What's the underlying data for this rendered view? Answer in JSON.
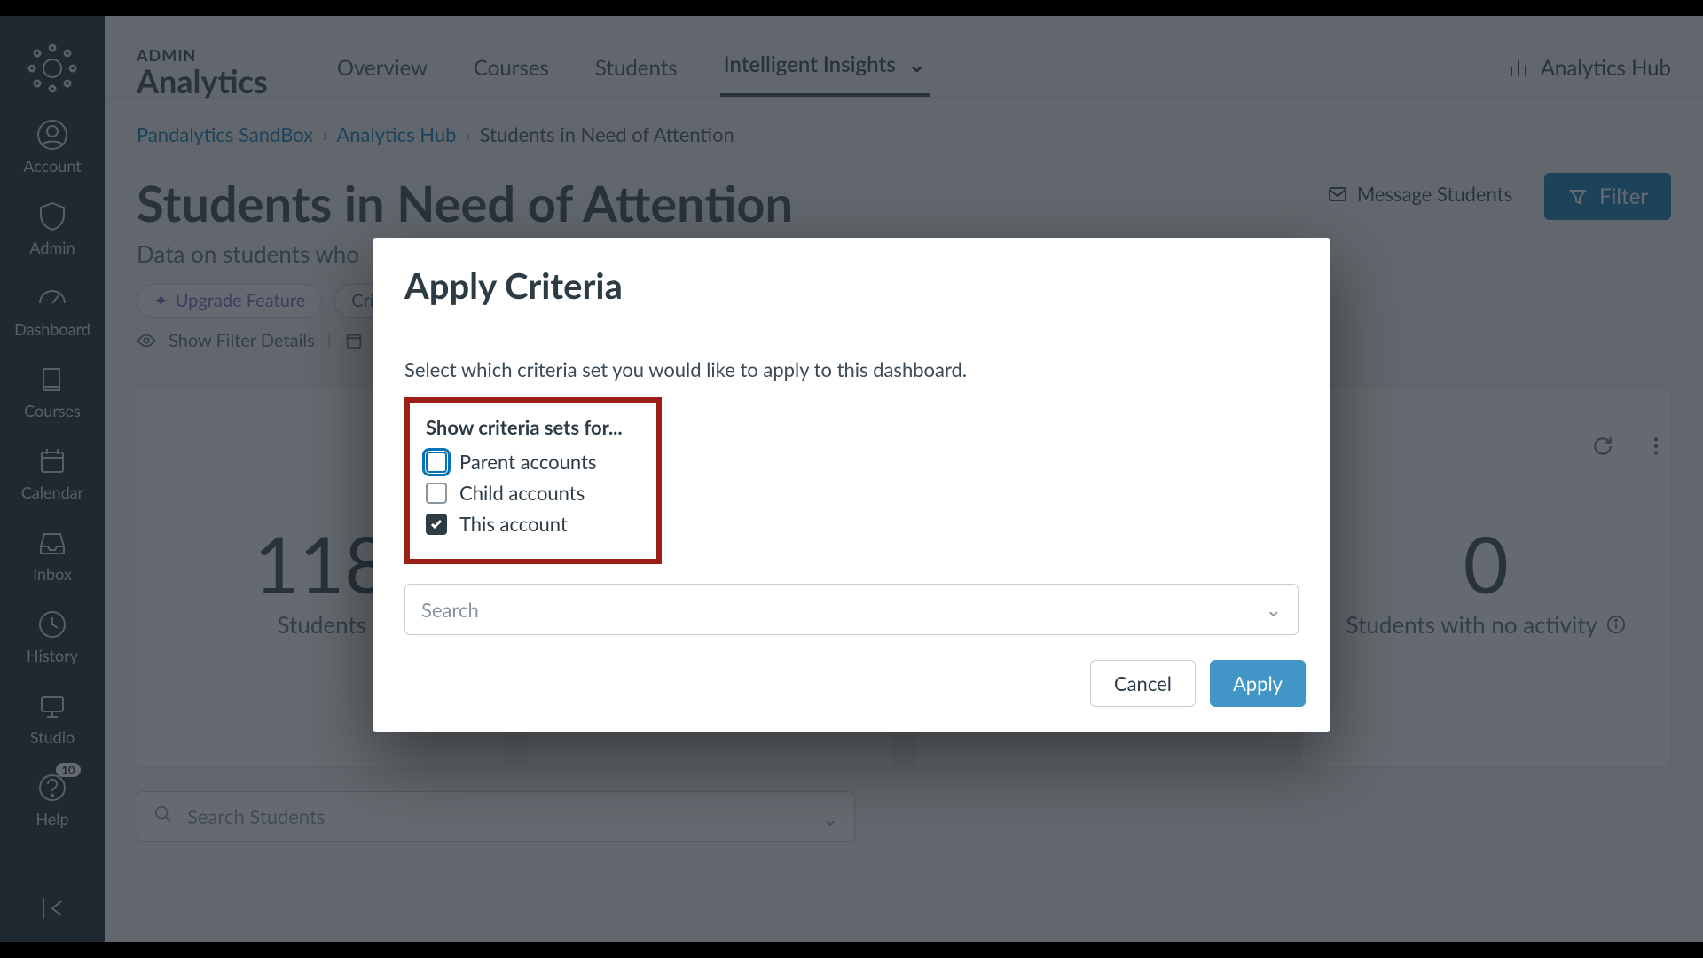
{
  "brand": {
    "sup": "ADMIN",
    "big": "Analytics"
  },
  "gnav": {
    "items": [
      {
        "key": "account",
        "label": "Account"
      },
      {
        "key": "admin",
        "label": "Admin"
      },
      {
        "key": "dashboard",
        "label": "Dashboard"
      },
      {
        "key": "courses",
        "label": "Courses"
      },
      {
        "key": "calendar",
        "label": "Calendar"
      },
      {
        "key": "inbox",
        "label": "Inbox"
      },
      {
        "key": "history",
        "label": "History"
      },
      {
        "key": "studio",
        "label": "Studio"
      },
      {
        "key": "help",
        "label": "Help",
        "badge": "10"
      }
    ]
  },
  "topnav": {
    "items": [
      {
        "label": "Overview"
      },
      {
        "label": "Courses"
      },
      {
        "label": "Students"
      },
      {
        "label": "Intelligent Insights",
        "active": true,
        "dropdown": true
      }
    ],
    "hub": "Analytics Hub"
  },
  "crumbs": [
    {
      "label": "Pandalytics SandBox",
      "link": true
    },
    {
      "label": "Analytics Hub",
      "link": true
    },
    {
      "label": "Students in Need of Attention",
      "link": false
    }
  ],
  "page": {
    "title": "Students in Need of Attention",
    "subtitle": "Data on students who",
    "message_btn": "Message Students",
    "filter_btn": "Filter",
    "upgrade_chip": "Upgrade Feature",
    "criteria_chip": "Criteria",
    "show_filter_details": "Show Filter Details"
  },
  "cards": [
    {
      "num": "118",
      "label": "Students"
    },
    {
      "num": "",
      "label": ""
    },
    {
      "num": "",
      "label": ""
    },
    {
      "num": "0",
      "label": "Students with no activity",
      "info": true
    }
  ],
  "search_students_placeholder": "Search Students",
  "modal": {
    "title": "Apply Criteria",
    "desc": "Select which criteria set you would like to apply to this dashboard.",
    "show_sets_header": "Show criteria sets for...",
    "opts": [
      {
        "label": "Parent accounts",
        "checked": false,
        "focus": true
      },
      {
        "label": "Child accounts",
        "checked": false
      },
      {
        "label": "This account",
        "checked": true
      }
    ],
    "search_placeholder": "Search",
    "cancel": "Cancel",
    "apply": "Apply"
  }
}
